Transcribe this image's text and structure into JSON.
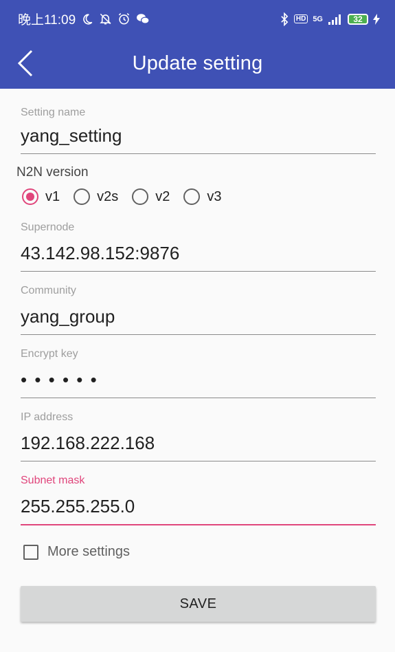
{
  "status_bar": {
    "time": "晚上11:09",
    "network": "5G",
    "hd": "HD",
    "battery": "32"
  },
  "app_bar": {
    "title": "Update setting"
  },
  "form": {
    "setting_name": {
      "label": "Setting name",
      "value": "yang_setting"
    },
    "n2n_version": {
      "label": "N2N version",
      "options": [
        "v1",
        "v2s",
        "v2",
        "v3"
      ],
      "selected": "v1"
    },
    "supernode": {
      "label": "Supernode",
      "value": "43.142.98.152:9876"
    },
    "community": {
      "label": "Community",
      "value": "yang_group"
    },
    "encrypt_key": {
      "label": "Encrypt key",
      "value": "• • • • • •"
    },
    "ip_address": {
      "label": "IP address",
      "value": "192.168.222.168"
    },
    "subnet_mask": {
      "label": "Subnet mask",
      "value": "255.255.255.0"
    },
    "more_settings": {
      "label": "More settings",
      "checked": false
    },
    "save_label": "SAVE"
  },
  "colors": {
    "primary": "#3f51b5",
    "accent": "#e0457b",
    "background": "#fafafa",
    "button": "#d6d7d7"
  }
}
